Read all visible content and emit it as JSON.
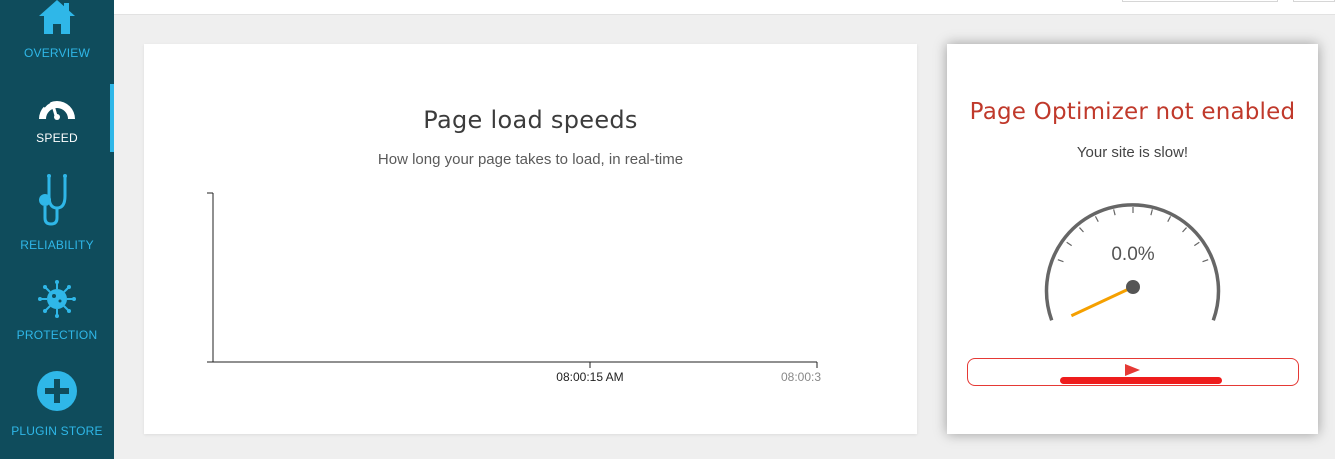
{
  "sidebar": {
    "items": [
      {
        "label": "OVERVIEW",
        "icon": "home-icon"
      },
      {
        "label": "SPEED",
        "icon": "speedometer-icon",
        "active": true
      },
      {
        "label": "RELIABILITY",
        "icon": "stethoscope-icon"
      },
      {
        "label": "PROTECTION",
        "icon": "virus-icon"
      },
      {
        "label": "PLUGIN STORE",
        "icon": "plus-circle-icon"
      }
    ],
    "colors": {
      "background": "#0f4c5c",
      "accent": "#2fb7e8",
      "active_text": "#ffffff"
    }
  },
  "chart_card": {
    "title": "Page load speeds",
    "subtitle": "How long your page takes to load, in real-time"
  },
  "chart_data": {
    "type": "line",
    "title": "Page load speeds",
    "subtitle": "How long your page takes to load, in real-time",
    "series": [],
    "x_tick_labels": [
      "08:00:15 AM",
      "08:00:3"
    ],
    "xlabel": "",
    "ylabel": "",
    "grid": false
  },
  "optimizer": {
    "title": "Page Optimizer not enabled",
    "subtitle": "Your site is slow!",
    "gauge_value": "0.0%",
    "gauge_fraction": 0.0,
    "colors": {
      "title": "#c0392b",
      "needle": "#f5a000",
      "button": "#e53935"
    }
  }
}
